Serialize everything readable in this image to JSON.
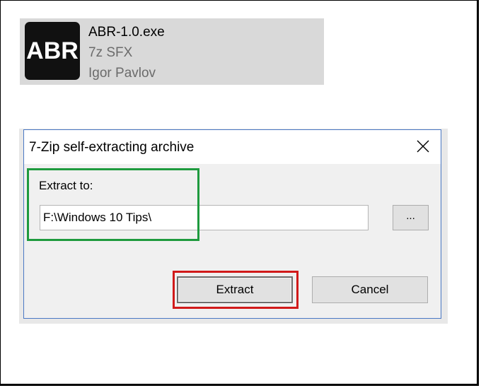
{
  "file": {
    "icon_text": "ABR",
    "icon_name": "abr-app-icon",
    "name": "ABR-1.0.exe",
    "type": "7z SFX",
    "author": "Igor Pavlov"
  },
  "dialog": {
    "title": "7-Zip self-extracting archive",
    "extract_label": "Extract to:",
    "path_value": "F:\\Windows 10 Tips\\",
    "browse_label": "...",
    "extract_button": "Extract",
    "cancel_button": "Cancel"
  },
  "colors": {
    "highlight_green": "#1e9a3e",
    "highlight_red": "#d11a1a",
    "dialog_border": "#4a78c4"
  }
}
